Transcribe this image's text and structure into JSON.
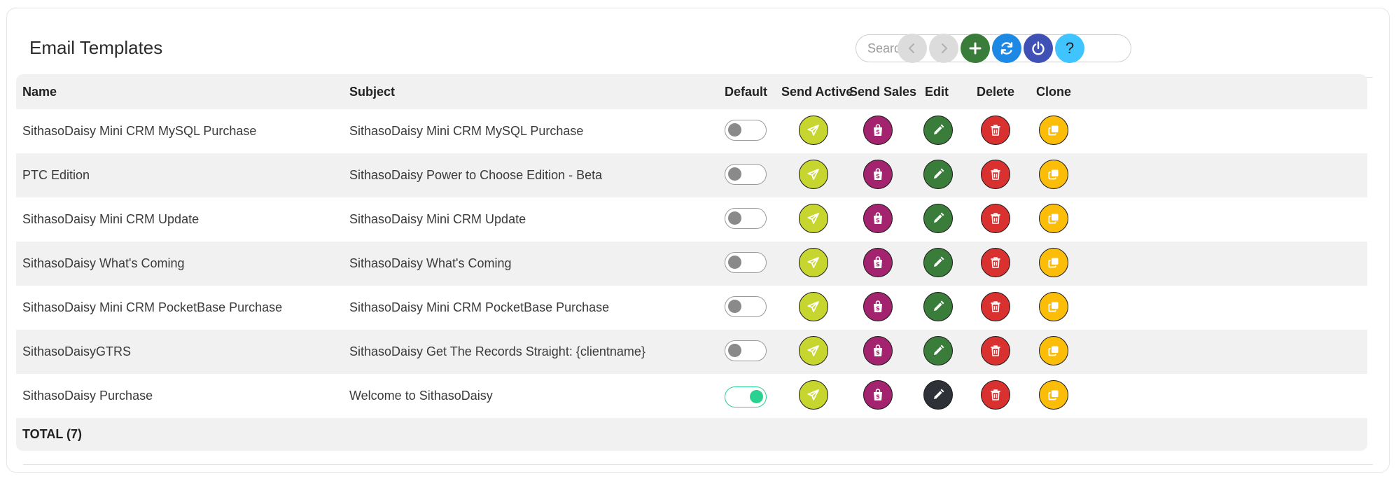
{
  "page": {
    "title": "Email Templates"
  },
  "search": {
    "placeholder": "Search",
    "value": ""
  },
  "toolbar": {
    "buttons": [
      {
        "name": "prev-page-button",
        "icon": "chevron-left-icon",
        "color": "#dcdcdc"
      },
      {
        "name": "next-page-button",
        "icon": "chevron-right-icon",
        "color": "#dcdcdc"
      },
      {
        "name": "add-button",
        "icon": "plus-icon",
        "color": "#3a7d3a"
      },
      {
        "name": "refresh-button",
        "icon": "refresh-icon",
        "color": "#1e88e5"
      },
      {
        "name": "logout-button",
        "icon": "power-icon",
        "color": "#3f51b5"
      },
      {
        "name": "help-button",
        "icon": "question-icon",
        "color": "#40c4ff",
        "label": "?"
      }
    ]
  },
  "table": {
    "columns": {
      "name": "Name",
      "subject": "Subject",
      "default": "Default",
      "send_active": "Send Active",
      "send_sales": "Send Sales",
      "edit": "Edit",
      "delete": "Delete",
      "clone": "Clone"
    },
    "rows": [
      {
        "name": "SithasoDaisy Mini CRM MySQL Purchase",
        "subject": "SithasoDaisy Mini CRM MySQL Purchase",
        "default": false
      },
      {
        "name": "PTC Edition",
        "subject": "SithasoDaisy Power to Choose Edition - Beta",
        "default": false
      },
      {
        "name": "SithasoDaisy Mini CRM Update",
        "subject": "SithasoDaisy Mini CRM Update",
        "default": false
      },
      {
        "name": "SithasoDaisy What's Coming",
        "subject": "SithasoDaisy What's Coming",
        "default": false
      },
      {
        "name": "SithasoDaisy Mini CRM PocketBase Purchase",
        "subject": "SithasoDaisy Mini CRM PocketBase Purchase",
        "default": false
      },
      {
        "name": "SithasoDaisyGTRS",
        "subject": "SithasoDaisy Get The Records Straight: {clientname}",
        "default": false
      },
      {
        "name": "SithasoDaisy Purchase",
        "subject": "Welcome to SithasoDaisy",
        "default": true
      }
    ],
    "footer": {
      "total_label": "TOTAL (7)"
    }
  },
  "actions": {
    "send_active": {
      "icon": "send-icon",
      "color": "#c6d62e"
    },
    "send_sales": {
      "icon": "shopify-bag-icon",
      "color": "#a3236f"
    },
    "edit": {
      "icon": "pencil-icon",
      "color": "#3a7d3a",
      "default_row_color": "#2f3138"
    },
    "delete": {
      "icon": "trash-icon",
      "color": "#d93030"
    },
    "clone": {
      "icon": "copy-icon",
      "color": "#fbbd08"
    }
  },
  "colors": {
    "toggle_on": "#2bd18f",
    "toggle_off": "#8a8a8a"
  }
}
